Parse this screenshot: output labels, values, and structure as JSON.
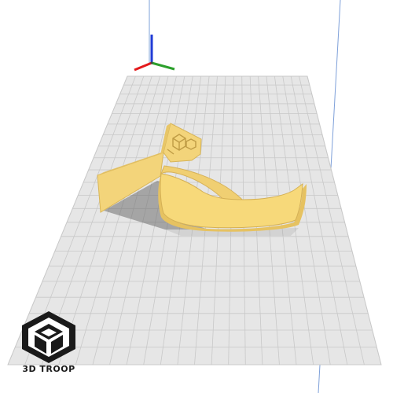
{
  "viewer": {
    "background_color": "#ffffff",
    "build_plate_color": "#e5e5e5",
    "grid_color": "#c8c8c8",
    "model_color": "#f7d97a",
    "model_shade_color": "#e9c35e",
    "axis_colors": {
      "x": "#e31a1c",
      "y": "#2ca02c",
      "z": "#1f3bd6"
    }
  },
  "model": {
    "type": "ring-shaped print model with embossed logo",
    "logo_icon": "3d-troop-logo-icon"
  },
  "brand": {
    "logo_icon": "cube-logo-icon",
    "text": "3D TROOP"
  }
}
